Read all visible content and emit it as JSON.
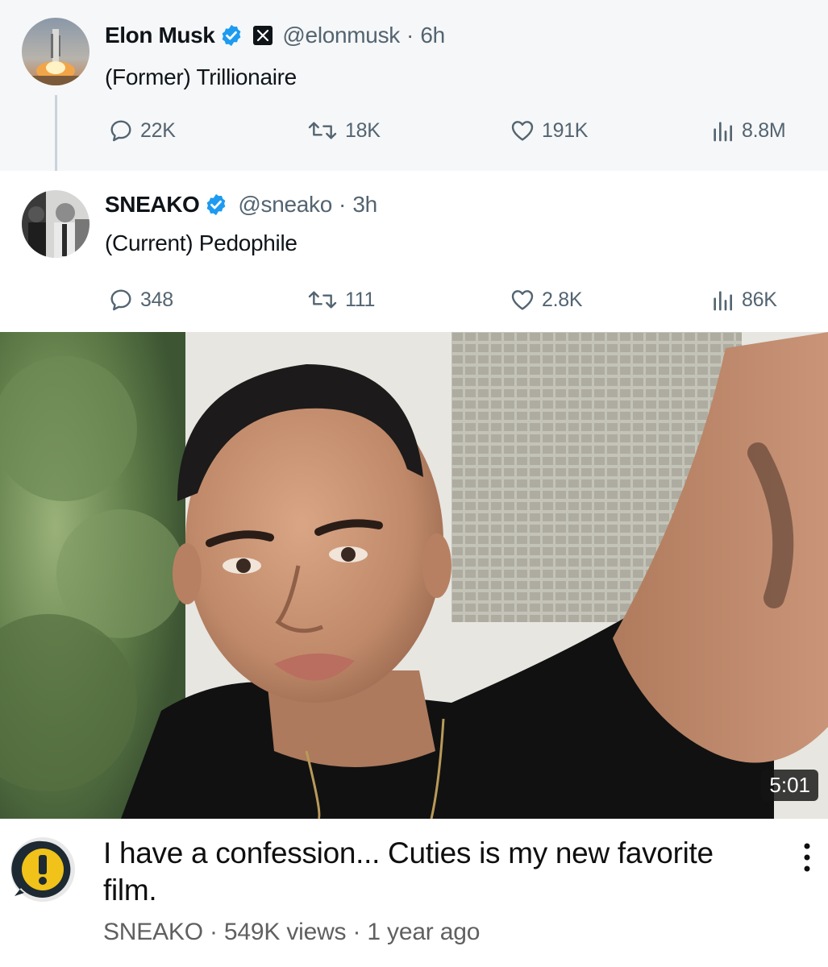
{
  "tweets": [
    {
      "name": "Elon Musk",
      "handle": "@elonmusk",
      "separator": "·",
      "time": "6h",
      "text": "(Former) Trillionaire",
      "replies": "22K",
      "reposts": "18K",
      "likes": "191K",
      "views": "8.8M"
    },
    {
      "name": "SNEAKO",
      "handle": "@sneako",
      "separator": "·",
      "time": "3h",
      "text": "(Current) Pedophile",
      "replies": "348",
      "reposts": "111",
      "likes": "2.8K",
      "views": "86K"
    }
  ],
  "video": {
    "duration": "5:01",
    "title": "I have a confession... Cuties is my new favorite film.",
    "channel": "SNEAKO",
    "views": "549K views",
    "age": "1 year ago",
    "separator": "·"
  },
  "colors": {
    "verified_blue": "#1d9bf0",
    "muted_text": "#536471",
    "tweet_bg": "#f6f7f8"
  },
  "icons": [
    "verified-badge-icon",
    "x-logo-icon",
    "reply-icon",
    "repost-icon",
    "like-icon",
    "views-icon",
    "more-vertical-icon"
  ]
}
